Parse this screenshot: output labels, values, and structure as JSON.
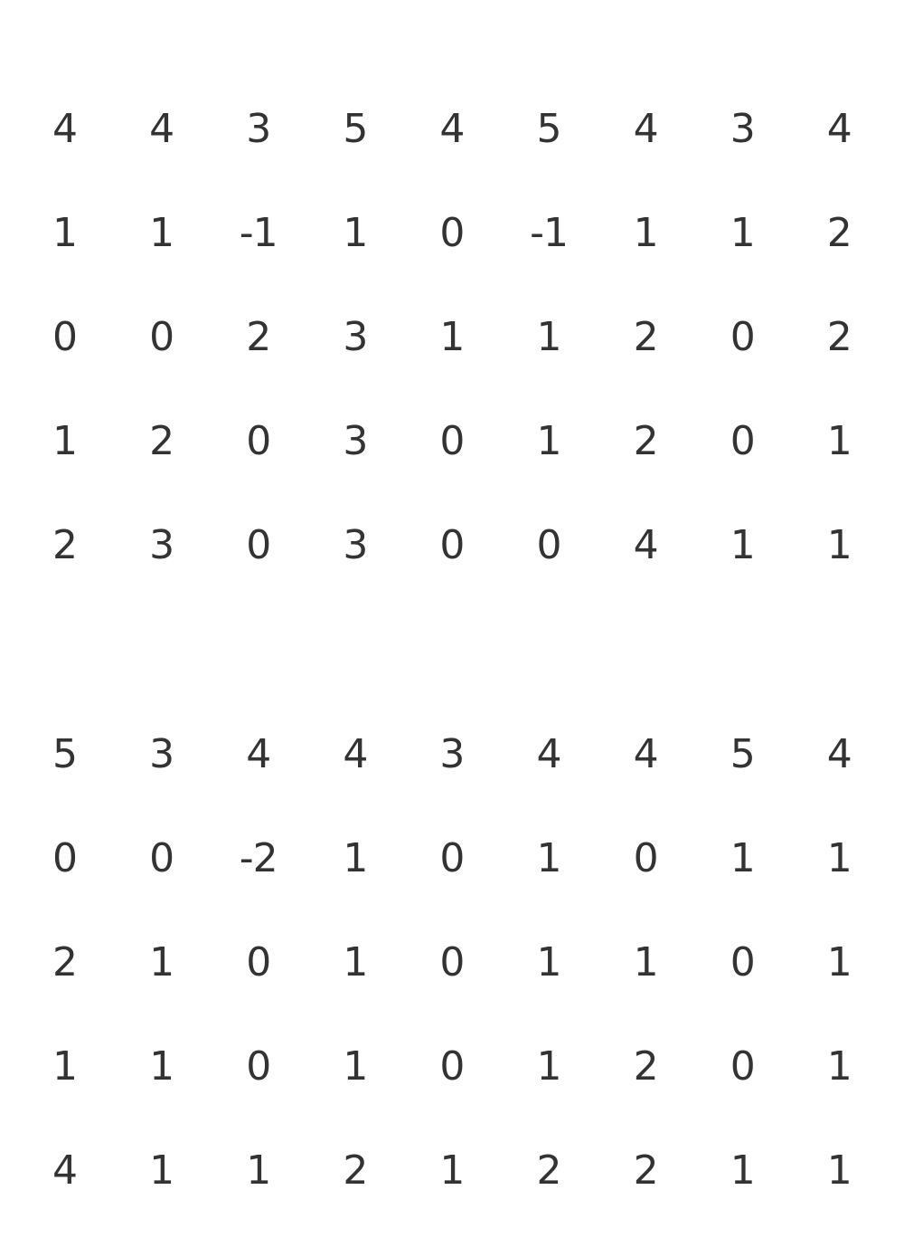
{
  "tables": [
    {
      "rows": [
        [
          "4",
          "4",
          "3",
          "5",
          "4",
          "5",
          "4",
          "3",
          "4"
        ],
        [
          "1",
          "1",
          "-1",
          "1",
          "0",
          "-1",
          "1",
          "1",
          "2"
        ],
        [
          "0",
          "0",
          "2",
          "3",
          "1",
          "1",
          "2",
          "0",
          "2"
        ],
        [
          "1",
          "2",
          "0",
          "3",
          "0",
          "1",
          "2",
          "0",
          "1"
        ],
        [
          "2",
          "3",
          "0",
          "3",
          "0",
          "0",
          "4",
          "1",
          "1"
        ]
      ]
    },
    {
      "rows": [
        [
          "5",
          "3",
          "4",
          "4",
          "3",
          "4",
          "4",
          "5",
          "4"
        ],
        [
          "0",
          "0",
          "-2",
          "1",
          "0",
          "1",
          "0",
          "1",
          "1"
        ],
        [
          "2",
          "1",
          "0",
          "1",
          "0",
          "1",
          "1",
          "0",
          "1"
        ],
        [
          "1",
          "1",
          "0",
          "1",
          "0",
          "1",
          "2",
          "0",
          "1"
        ],
        [
          "4",
          "1",
          "1",
          "2",
          "1",
          "2",
          "2",
          "1",
          "1"
        ]
      ]
    }
  ]
}
